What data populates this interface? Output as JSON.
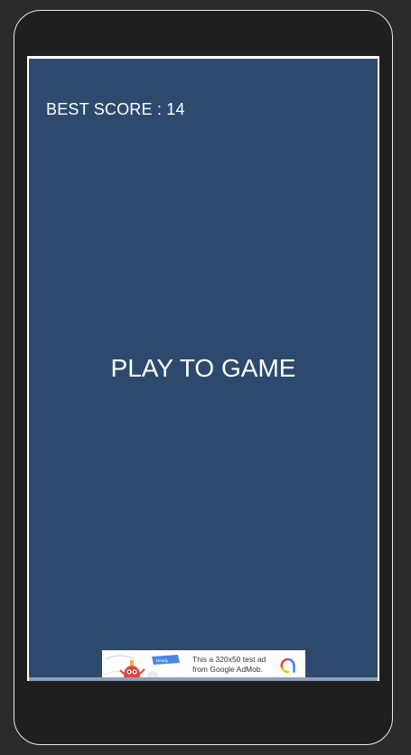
{
  "game": {
    "best_score_label": "BEST SCORE : 14",
    "play_label": "PLAY TO GAME"
  },
  "ad": {
    "line1": "This a 320x50 test ad",
    "line2": "from Google AdMob.",
    "badge_text": "Ready",
    "mascot": "red-monster-icon",
    "logo": "admob-logo-icon"
  },
  "colors": {
    "background": "#2b2b2b",
    "frame": "#1f1f1f",
    "screen": "#2d4a6e",
    "text": "#ffffff"
  }
}
